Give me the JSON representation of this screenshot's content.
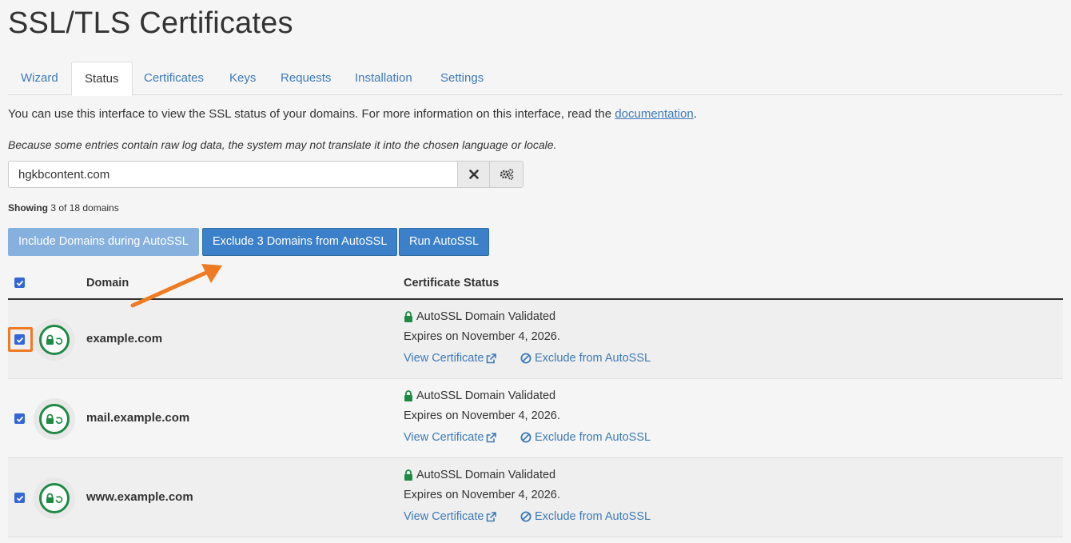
{
  "page": {
    "title": "SSL/TLS Certificates"
  },
  "tabs": [
    {
      "label": "Wizard"
    },
    {
      "label": "Status",
      "active": true
    },
    {
      "label": "Certificates"
    },
    {
      "label": "Keys"
    },
    {
      "label": "Requests"
    },
    {
      "label": "Installation"
    },
    {
      "label": "Settings"
    }
  ],
  "intro": {
    "text": "You can use this interface to view the SSL status of your domains. For more information on this interface, read the ",
    "link": "documentation",
    "end": "."
  },
  "note": "Because some entries contain raw log data, the system may not translate it into the chosen language or locale.",
  "search": {
    "value": "hgkbcontent.com",
    "clear_icon": "close-icon",
    "options_icon": "gears-icon"
  },
  "showing": {
    "label": "Showing",
    "text": "3 of 18 domains"
  },
  "actions": {
    "include": "Include Domains during AutoSSL",
    "exclude": "Exclude 3 Domains from AutoSSL",
    "run": "Run AutoSSL"
  },
  "table": {
    "headers": {
      "domain": "Domain",
      "status": "Certificate Status"
    },
    "rows": [
      {
        "domain": "example.com",
        "status": "AutoSSL Domain Validated",
        "expires": "Expires on November 4, 2026.",
        "view": "View Certificate",
        "exclude": "Exclude from AutoSSL",
        "checked": true
      },
      {
        "domain": "mail.example.com",
        "status": "AutoSSL Domain Validated",
        "expires": "Expires on November 4, 2026.",
        "view": "View Certificate",
        "exclude": "Exclude from AutoSSL",
        "checked": true
      },
      {
        "domain": "www.example.com",
        "status": "AutoSSL Domain Validated",
        "expires": "Expires on November 4, 2026.",
        "view": "View Certificate",
        "exclude": "Exclude from AutoSSL",
        "checked": true
      }
    ]
  },
  "colors": {
    "link": "#3d7ab8",
    "primary": "#3b80c9",
    "success": "#1e8a43",
    "annotation": "#f07a22"
  }
}
